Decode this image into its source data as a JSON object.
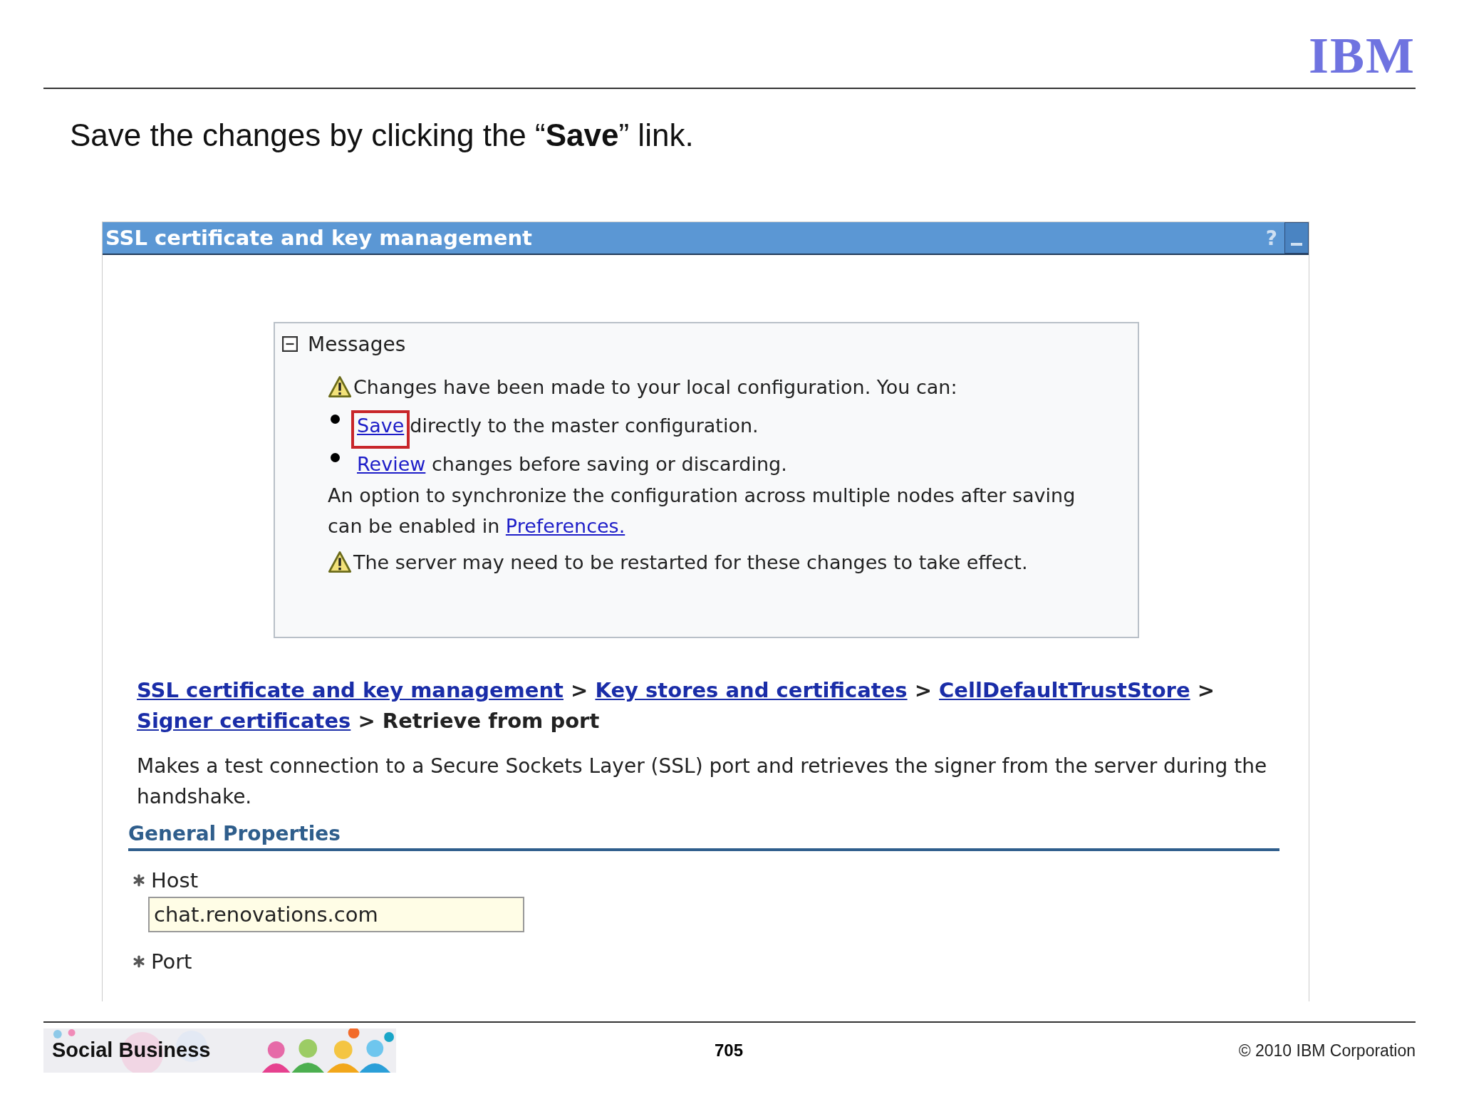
{
  "slide": {
    "logo": "IBM",
    "title": "Save the changes by clicking the “**Save**” link.",
    "banner": "Social Business",
    "page_number": "705",
    "copyright": "© 2010 IBM Corporation"
  },
  "panel": {
    "title": "SSL certificate and key management",
    "help": "?",
    "messages": {
      "title": "Messages",
      "expanded": true,
      "items": [
        {
          "kind": "warning",
          "text": "Changes have been made to your local configuration. You can:"
        },
        {
          "kind": "bullet",
          "link": "Save ",
          "text": "directly to the master configuration.",
          "highlighted": true
        },
        {
          "kind": "bullet",
          "link": "Review",
          "text": " changes before saving or discarding.",
          "highlighted": false
        },
        {
          "kind": "note",
          "text": "An option to synchronize the configuration across multiple nodes after saving can be enabled in ",
          "link": "Preferences."
        },
        {
          "kind": "warning",
          "text": "The server may need to be restarted for these changes to take effect."
        }
      ]
    },
    "breadcrumb": {
      "links": [
        "SSL certificate and key management",
        "Key stores and certificates",
        "CellDefaultTrustStore",
        "Signer certificates"
      ],
      "separator": ">",
      "current": "Retrieve from port"
    },
    "description": "Makes a test connection to a Secure Sockets Layer (SSL) port and retrieves the signer from the server during the handshake.",
    "section": "General Properties",
    "fields": [
      {
        "label": "Host",
        "required": true,
        "value": "chat.renovations.com"
      },
      {
        "label": "Port",
        "required": true
      }
    ]
  }
}
